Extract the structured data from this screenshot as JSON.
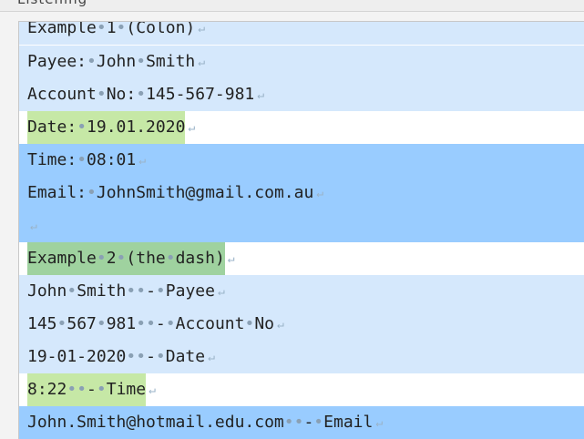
{
  "header": {
    "title": "Listening"
  },
  "lines": [
    {
      "segments": [
        "Example",
        "1",
        "(Colon)"
      ],
      "style": "light",
      "highlight": ""
    },
    {
      "segments": [
        "Payee:",
        "John",
        "Smith"
      ],
      "style": "light",
      "highlight": ""
    },
    {
      "segments": [
        "Account",
        "No:",
        "145-567-981"
      ],
      "style": "light",
      "highlight": ""
    },
    {
      "segments": [
        "Date:",
        "19.01.2020"
      ],
      "style": "white",
      "highlight": "green"
    },
    {
      "segments": [
        "Time:",
        "08:01"
      ],
      "style": "blue",
      "highlight": ""
    },
    {
      "segments": [
        "Email:",
        "JohnSmith@gmail.com.au"
      ],
      "style": "blue",
      "highlight": ""
    },
    {
      "segments": [
        ""
      ],
      "style": "blue",
      "highlight": ""
    },
    {
      "segments": [
        "Example",
        "2",
        "(the",
        "dash)"
      ],
      "style": "white",
      "highlight": "green-dark"
    },
    {
      "segments": [
        "John",
        "Smith",
        "",
        "-",
        "Payee"
      ],
      "style": "light",
      "highlight": ""
    },
    {
      "segments": [
        "145",
        "567",
        "981",
        "",
        "-",
        "Account",
        "No"
      ],
      "style": "light",
      "highlight": ""
    },
    {
      "segments": [
        "19-01-2020",
        "",
        "-",
        "Date"
      ],
      "style": "light",
      "highlight": ""
    },
    {
      "segments": [
        "8:22",
        "",
        "-",
        "Time"
      ],
      "style": "white",
      "highlight": "green"
    },
    {
      "segments": [
        "John.Smith@hotmail.edu.com",
        "",
        "-",
        "Email"
      ],
      "style": "blue",
      "highlight": ""
    }
  ],
  "symbols": {
    "space_dot": "•",
    "paragraph_mark": "↵"
  },
  "colors": {
    "light_line": "#d5e8fc",
    "selected_line": "#99ccff",
    "green_highlight": "#c6e8a6",
    "green_dark_highlight": "#9fd29f"
  }
}
